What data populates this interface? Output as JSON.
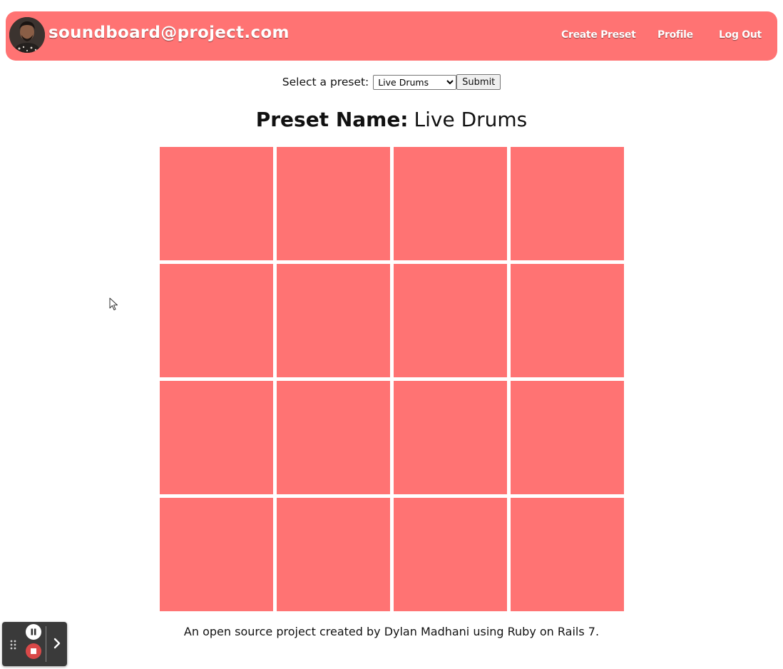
{
  "nav": {
    "brand": "soundboard@project.com",
    "links": [
      {
        "label": "Create Preset"
      },
      {
        "label": "Profile"
      },
      {
        "label": "Log Out"
      }
    ]
  },
  "preset_selector": {
    "label": "Select a preset:",
    "selected": "Live Drums",
    "submit_label": "Submit"
  },
  "preset": {
    "name_label": "Preset Name:",
    "name_value": "Live Drums"
  },
  "pads": {
    "rows": 4,
    "columns": 4,
    "count": 16
  },
  "footer": {
    "text": "An open source project created by Dylan Madhani using Ruby on Rails 7."
  },
  "colors": {
    "accent": "#ff7373",
    "recorder_bg": "#3a3a3a",
    "record_stop": "#d94848"
  },
  "icons": {
    "avatar": "user-avatar",
    "cursor": "mouse-pointer-icon",
    "grip": "drag-grip-icon",
    "pause": "pause-icon",
    "stop": "stop-icon",
    "expand": "chevron-right-icon"
  }
}
